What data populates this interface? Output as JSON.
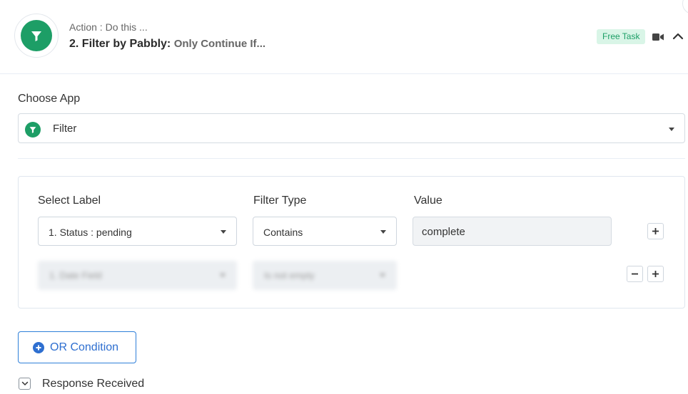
{
  "header": {
    "subtitle": "Action : Do this ...",
    "title": "2. Filter by Pabbly:",
    "title_suffix": "Only Continue If...",
    "badge": "Free Task",
    "icons": [
      "filter-icon",
      "video-icon",
      "chevron-up-icon"
    ]
  },
  "choose_app": {
    "label": "Choose App",
    "selected": "Filter",
    "icon": "filter-icon"
  },
  "filter": {
    "columns": {
      "label": "Select Label",
      "type": "Filter Type",
      "value": "Value"
    },
    "rows": [
      {
        "label": "1. Status : pending",
        "type": "Contains",
        "value": "complete"
      },
      {
        "label": "1. Date Field",
        "type": "Is not empty",
        "value": ""
      }
    ]
  },
  "or_condition": {
    "label": "OR Condition",
    "icon": "plus-circle-icon"
  },
  "response": {
    "label": "Response Received",
    "icon": "chevron-down-icon"
  },
  "colors": {
    "brand_green": "#1d9e66",
    "badge_bg": "#d9f5e7",
    "accent_blue": "#2e6fd0"
  }
}
